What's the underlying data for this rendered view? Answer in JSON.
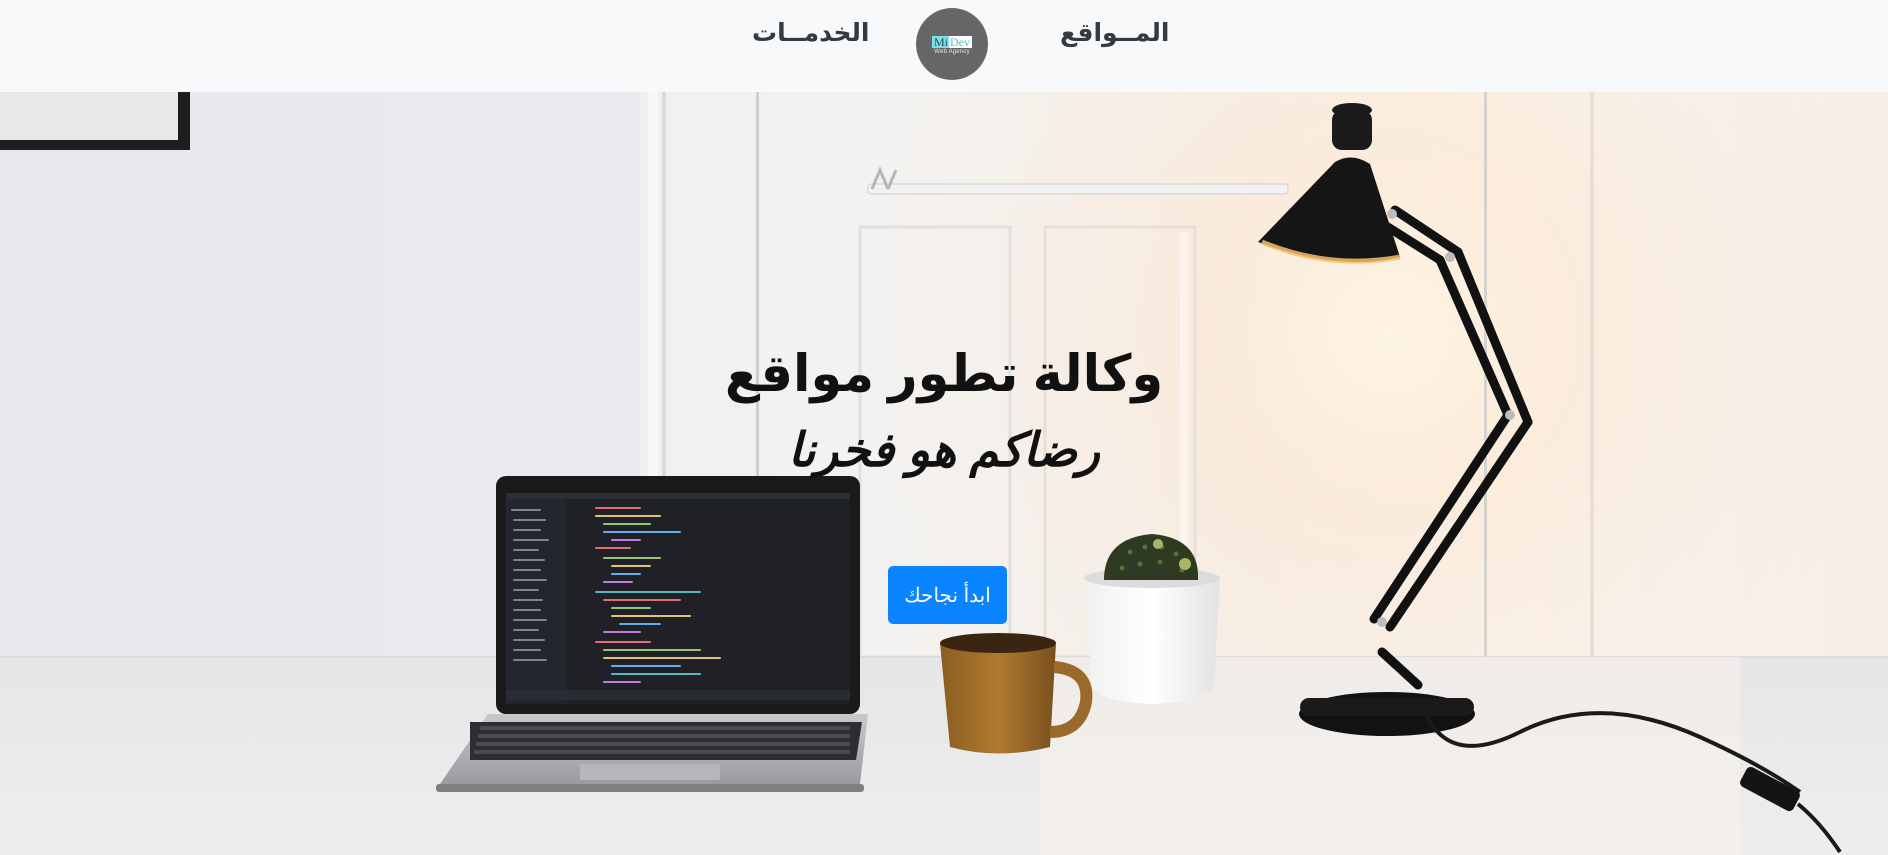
{
  "navbar": {
    "services_label": "الخدمــات",
    "sites_label": "المــواقع",
    "logo": {
      "text_part1": "Mi",
      "text_part2": "Dev",
      "tagline": "Web Agency",
      "bg_color": "#666666"
    }
  },
  "hero": {
    "title": "وكالة تطور مواقع",
    "subtitle": "رضاكم هو فخرنا",
    "cta_label": "ابدأ نجاحك",
    "cta_color": "#0a84ff",
    "background_image": "desk-with-laptop-lamp-cactus-mug"
  }
}
